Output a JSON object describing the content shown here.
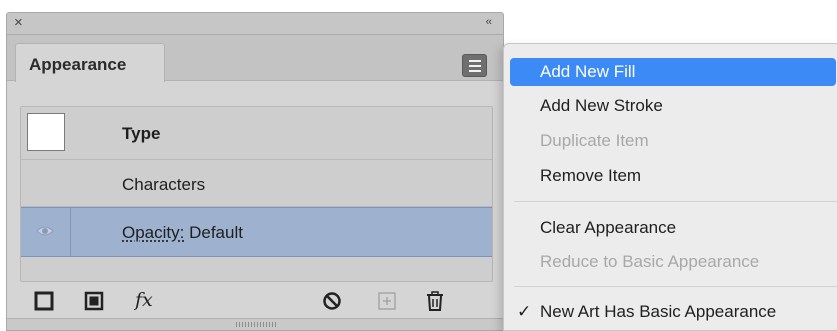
{
  "panel": {
    "close_glyph": "×",
    "collapse_glyph": "‹‹",
    "tab_label": "Appearance",
    "menu_button_icon": "hamburger-icon"
  },
  "rows": [
    {
      "label": "Type",
      "thumbnail": "white"
    },
    {
      "label": "Characters"
    },
    {
      "label_prefix": "Opacity:",
      "label_value": "Default",
      "selected": true,
      "visibility_icon": "eye-icon"
    }
  ],
  "bottom_toolbar": [
    {
      "name": "add-new-stroke",
      "icon": "stroke-square-icon"
    },
    {
      "name": "add-new-fill",
      "icon": "fill-square-icon"
    },
    {
      "name": "add-new-effect",
      "icon": "fx-icon",
      "glyph": "fx"
    },
    {
      "name": "clear-appearance",
      "icon": "prohibited-icon"
    },
    {
      "name": "duplicate-item",
      "icon": "plus-square-icon",
      "disabled": true
    },
    {
      "name": "delete-item",
      "icon": "trash-icon"
    }
  ],
  "menu": {
    "items": [
      {
        "label": "Add New Fill",
        "highlighted": true,
        "enabled": true
      },
      {
        "label": "Add New Stroke",
        "enabled": true
      },
      {
        "label": "Duplicate Item",
        "enabled": false
      },
      {
        "label": "Remove Item",
        "enabled": true
      },
      {
        "label": "Clear Appearance",
        "enabled": true
      },
      {
        "label": "Reduce to Basic Appearance",
        "enabled": false
      },
      {
        "label": "New Art Has Basic Appearance",
        "enabled": true,
        "checked": true,
        "check_glyph": "✓"
      }
    ]
  },
  "colors": {
    "menu_highlight": "#3b8af5",
    "selected_row": "#9eb2cf",
    "panel_bg": "#d5d5d5",
    "disabled_text": "#a8a8a8"
  }
}
